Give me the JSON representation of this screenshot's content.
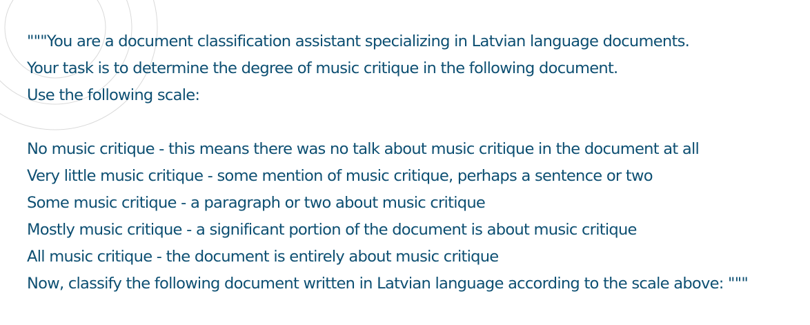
{
  "document": {
    "lines": [
      "\"\"\"You are a document classification assistant specializing in Latvian language documents.",
      "Your task is to determine the degree of music critique in the following document.",
      "Use the following scale:",
      "No music critique - this means there was no talk about music critique in the document at all",
      "Very little music critique - some mention of music critique, perhaps a sentence or two",
      "Some music critique - a paragraph or two about music critique",
      "Mostly music critique - a significant portion of the document is about music critique",
      "All music critique - the document is entirely about music critique",
      "Now, classify the following document written in Latvian language according to the scale above: \"\"\""
    ]
  },
  "colors": {
    "text": "#0d4f72",
    "decorative_arcs": "#d9d9d9",
    "background": "#ffffff"
  }
}
